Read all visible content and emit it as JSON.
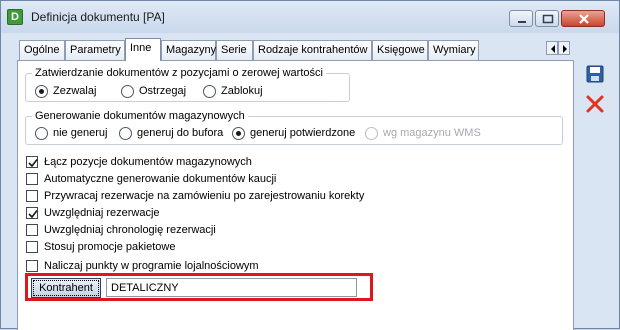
{
  "window": {
    "title": "Definicja dokumentu [PA]",
    "app_icon_letter": "D"
  },
  "tabs": [
    {
      "label": "Ogólne",
      "active": false
    },
    {
      "label": "Parametry",
      "active": false
    },
    {
      "label": "Inne",
      "active": true
    },
    {
      "label": "Magazyny",
      "active": false
    },
    {
      "label": "Serie",
      "active": false
    },
    {
      "label": "Rodzaje kontrahentów",
      "active": false
    },
    {
      "label": "Księgowe",
      "active": false
    },
    {
      "label": "Wymiary",
      "active": false
    }
  ],
  "zero_value_group": {
    "title": "Zatwierdzanie dokumentów z pozycjami o zerowej wartości",
    "options": [
      {
        "label": "Zezwalaj",
        "selected": true
      },
      {
        "label": "Ostrzegaj",
        "selected": false
      },
      {
        "label": "Zablokuj",
        "selected": false
      }
    ]
  },
  "warehouse_group": {
    "title": "Generowanie dokumentów magazynowych",
    "options": [
      {
        "label": "nie generuj",
        "selected": false,
        "disabled": false
      },
      {
        "label": "generuj do bufora",
        "selected": false,
        "disabled": false
      },
      {
        "label": "generuj potwierdzone",
        "selected": true,
        "disabled": false
      },
      {
        "label": "wg magazynu WMS",
        "selected": false,
        "disabled": true
      }
    ]
  },
  "checkboxes": [
    {
      "label": "Łącz pozycje dokumentów magazynowych",
      "checked": true
    },
    {
      "label": "Automatyczne generowanie dokumentów kaucji",
      "checked": false
    },
    {
      "label": "Przywracaj rezerwacje na zamówieniu po zarejestrowaniu korekty",
      "checked": false
    },
    {
      "label": "Uwzględniaj rezerwacje",
      "checked": true
    },
    {
      "label": "Uwzględniaj chronologię rezerwacji",
      "checked": false
    },
    {
      "label": "Stosuj promocje pakietowe",
      "checked": false
    },
    {
      "label": "Naliczaj punkty w programie lojalnościowym",
      "checked": false
    }
  ],
  "kontrahent": {
    "button_label": "Kontrahent",
    "value": "DETALICZNY"
  },
  "colors": {
    "highlight": "#e0161f",
    "save_icon": "#2f5fa8",
    "cancel_icon": "#e0321c"
  }
}
